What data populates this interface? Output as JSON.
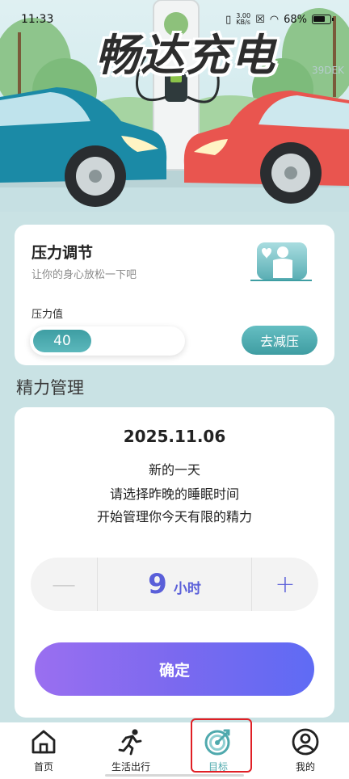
{
  "status_bar": {
    "time": "11:33",
    "network_speed": "3.00",
    "network_unit": "KB/s",
    "battery": "68%"
  },
  "hero": {
    "title": "畅达充电",
    "watermark": "39DEK"
  },
  "stress_card": {
    "title": "压力调节",
    "subtitle": "让你的身心放松一下吧",
    "value_label": "压力值",
    "value": "40",
    "value_fraction": 0.4,
    "relieve_button": "去减压"
  },
  "energy_section": {
    "title": "精力管理",
    "date": "2025.11.06",
    "line1": "新的一天",
    "line2": "请选择昨晚的睡眠时间",
    "line3": "开始管理你今天有限的精力",
    "minus": "—",
    "plus": "+",
    "hours": "9",
    "hours_unit": "小时",
    "confirm_button": "确定"
  },
  "nav": {
    "items": [
      {
        "label": "首页",
        "icon": "home-icon"
      },
      {
        "label": "生活出行",
        "icon": "running-icon"
      },
      {
        "label": "目标",
        "icon": "target-icon",
        "active": true
      },
      {
        "label": "我的",
        "icon": "user-icon"
      }
    ]
  },
  "colors": {
    "accent_teal": "#4fa9ad",
    "accent_purple": "#5a5fd9",
    "highlight_red": "#e01f25",
    "background": "#c9e2e4"
  }
}
